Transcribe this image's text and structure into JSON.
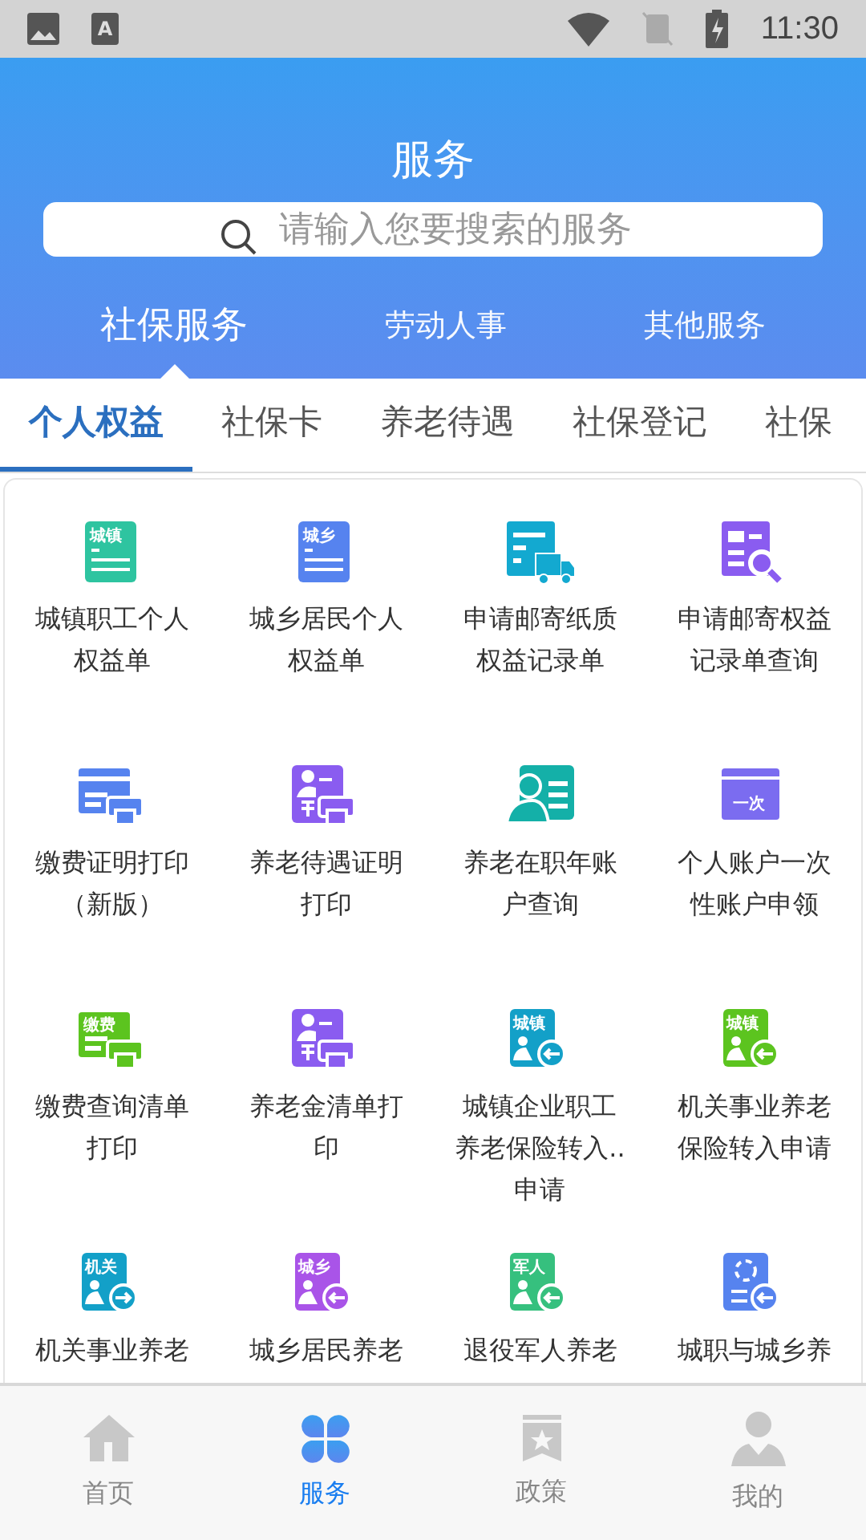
{
  "status_bar": {
    "keyboard_letter": "A",
    "time": "11:30"
  },
  "header": {
    "title": "服务",
    "search": {
      "placeholder": "请输入您要搜索的服务"
    }
  },
  "categories": [
    {
      "label": "社保服务",
      "selected": true
    },
    {
      "label": "劳动人事",
      "selected": false
    },
    {
      "label": "其他服务",
      "selected": false
    }
  ],
  "tabs": [
    {
      "label": "个人权益",
      "selected": true
    },
    {
      "label": "社保卡",
      "selected": false
    },
    {
      "label": "养老待遇",
      "selected": false
    },
    {
      "label": "社保登记",
      "selected": false
    },
    {
      "label": "社保",
      "selected": false
    }
  ],
  "services": [
    {
      "kind": "doc",
      "color": "#2ec4a0",
      "badge": "城镇",
      "lines": [
        "城镇职工个人",
        "权益单"
      ]
    },
    {
      "kind": "doc",
      "color": "#5683ef",
      "badge": "城乡",
      "lines": [
        "城乡居民个人",
        "权益单"
      ]
    },
    {
      "kind": "truck",
      "color": "#13a9d0",
      "lines": [
        "申请邮寄纸质",
        "权益记录单"
      ]
    },
    {
      "kind": "search-doc",
      "color": "#8a5cf0",
      "lines": [
        "申请邮寄权益",
        "记录单查询"
      ]
    },
    {
      "kind": "print",
      "color": "#5683ef",
      "lines": [
        "缴费证明打印",
        "（新版）"
      ]
    },
    {
      "kind": "elder-print",
      "color": "#8a5cf0",
      "lines": [
        "养老待遇证明",
        "打印"
      ]
    },
    {
      "kind": "person-card",
      "color": "#14b0a8",
      "lines": [
        "养老在职年账",
        "户查询"
      ]
    },
    {
      "kind": "card",
      "color": "#7b6cf0",
      "badge": "一次",
      "lines": [
        "个人账户一次",
        "性账户申领"
      ]
    },
    {
      "kind": "print",
      "color": "#5cc41f",
      "badge": "缴费",
      "lines": [
        "缴费查询清单",
        "打印"
      ]
    },
    {
      "kind": "elder-print",
      "color": "#8a5cf0",
      "lines": [
        "养老金清单打",
        "印"
      ]
    },
    {
      "kind": "transfer-in",
      "color": "#13a0c8",
      "badge": "城镇",
      "lines": [
        "城镇企业职工",
        "养老保险转入..",
        "申请"
      ]
    },
    {
      "kind": "transfer-in",
      "color": "#5cc41f",
      "badge": "城镇",
      "lines": [
        "机关事业养老",
        "保险转入申请"
      ]
    },
    {
      "kind": "transfer-out",
      "color": "#13a0c8",
      "badge": "机关",
      "lines": [
        "机关事业养老"
      ]
    },
    {
      "kind": "transfer-in",
      "color": "#a954e8",
      "badge": "城乡",
      "lines": [
        "城乡居民养老"
      ]
    },
    {
      "kind": "transfer-in",
      "color": "#36c07e",
      "badge": "军人",
      "lines": [
        "退役军人养老"
      ]
    },
    {
      "kind": "cycle",
      "color": "#5683ef",
      "lines": [
        "城职与城乡养"
      ]
    }
  ],
  "bottom_nav": [
    {
      "label": "首页",
      "kind": "home",
      "selected": false
    },
    {
      "label": "服务",
      "kind": "service",
      "selected": true
    },
    {
      "label": "政策",
      "kind": "policy",
      "selected": false
    },
    {
      "label": "我的",
      "kind": "me",
      "selected": false
    }
  ]
}
